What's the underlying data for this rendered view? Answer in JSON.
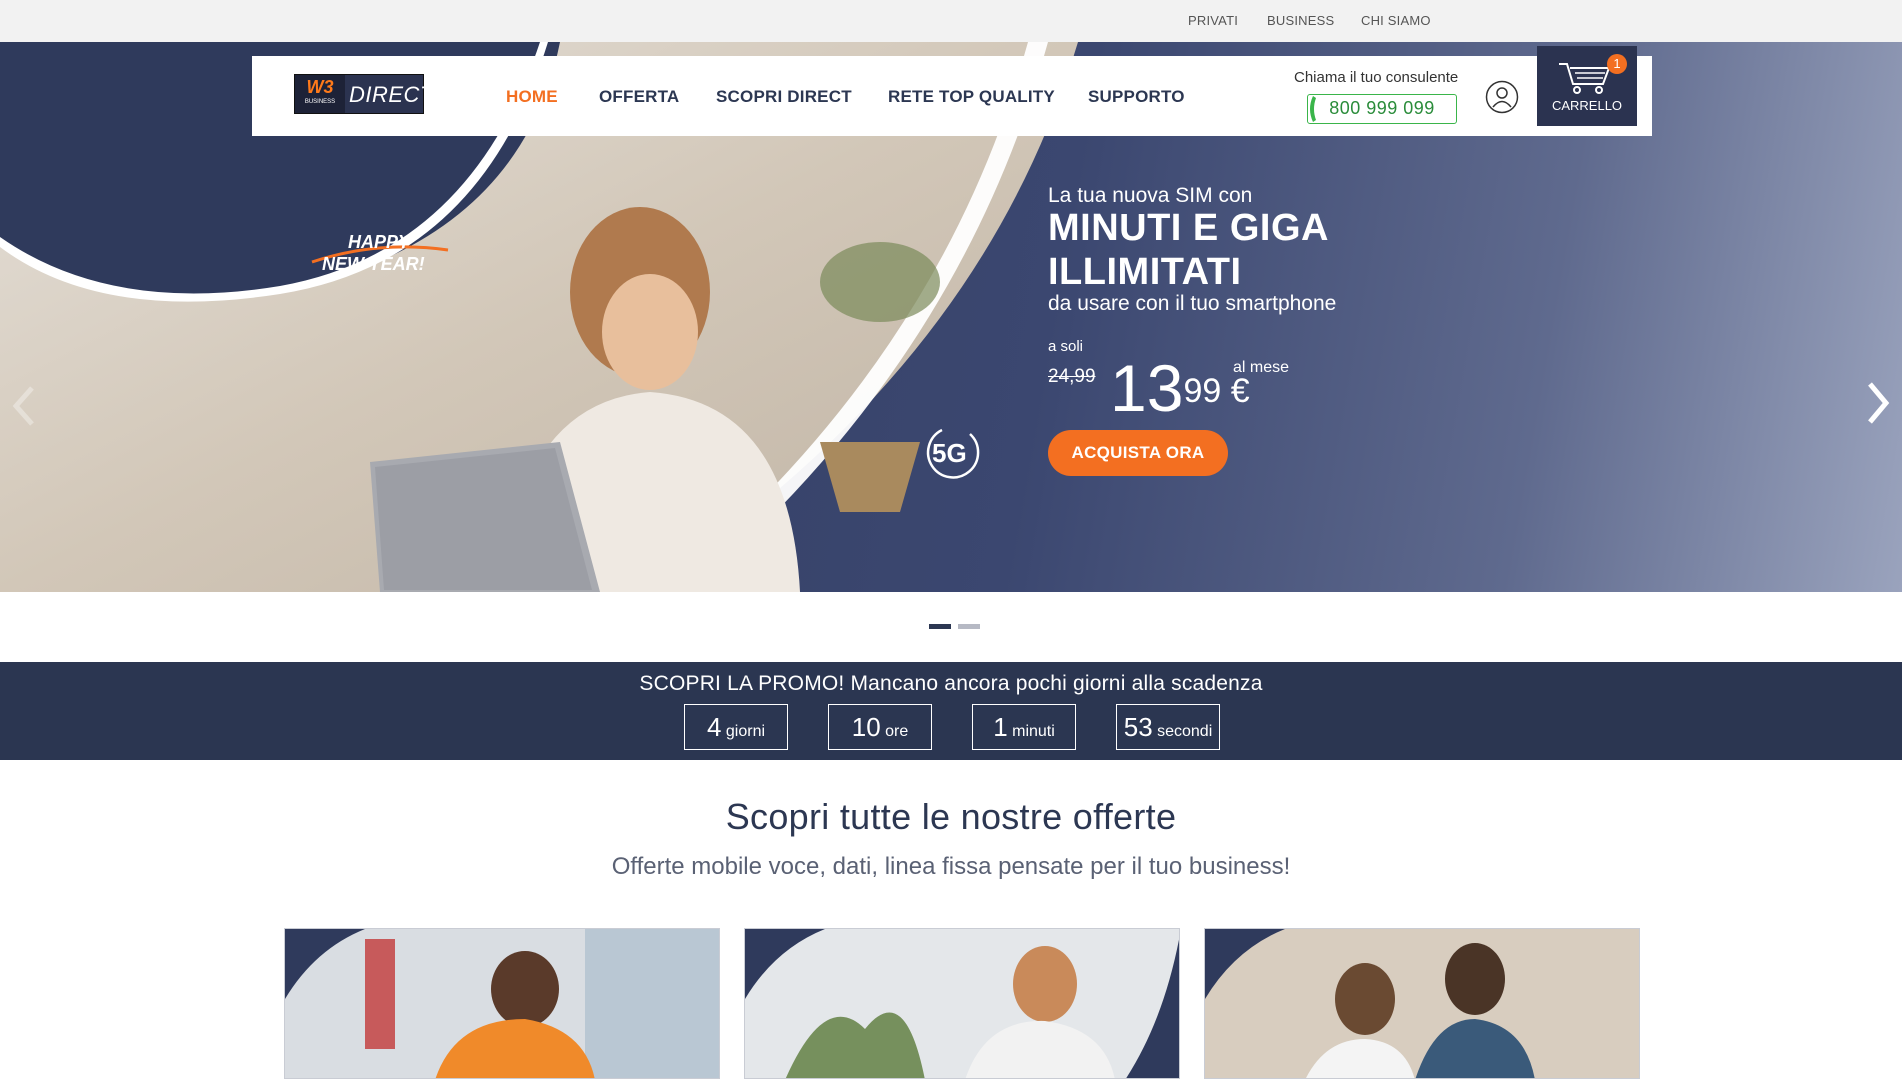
{
  "topbar": {
    "links": [
      "PRIVATI",
      "BUSINESS",
      "CHI SIAMO"
    ]
  },
  "header": {
    "logo_brand": "W3",
    "logo_small": "BUSINESS",
    "logo_text": "DIRECT",
    "nav": [
      "HOME",
      "OFFERTA",
      "SCOPRI DIRECT",
      "RETE TOP QUALITY",
      "SUPPORTO"
    ],
    "active_nav": "HOME",
    "consult_label": "Chiama il tuo consulente",
    "phone": "800 999 099",
    "cart_label": "CARRELLO",
    "cart_count": "1"
  },
  "hero": {
    "badge_line1": "HAPPY",
    "badge_line2": "NEW YEAR!",
    "network_badge": "5G",
    "subtitle1": "La tua nuova SIM con",
    "title": "MINUTI E GIGA ILLIMITATI",
    "subtitle2": "da usare con il tuo smartphone",
    "price_prefix": "a soli",
    "price_old": "24,99",
    "price_int": "13",
    "price_dec": ",99 €",
    "price_period": "al mese",
    "cta": "ACQUISTA ORA"
  },
  "carousel": {
    "slides": 2,
    "active": 1
  },
  "promo": {
    "title": "SCOPRI LA PROMO! Mancano ancora pochi giorni alla scadenza",
    "countdown": [
      {
        "value": "4",
        "unit": "giorni"
      },
      {
        "value": "10",
        "unit": "ore"
      },
      {
        "value": "1",
        "unit": "minuti"
      },
      {
        "value": "53",
        "unit": "secondi"
      }
    ]
  },
  "offers": {
    "title": "Scopri tutte le nostre offerte",
    "subtitle": "Offerte mobile voce, dati, linea fissa pensate per il tuo business!"
  },
  "colors": {
    "accent": "#f36f21",
    "navy": "#2b3651",
    "green": "#3ab54a"
  }
}
